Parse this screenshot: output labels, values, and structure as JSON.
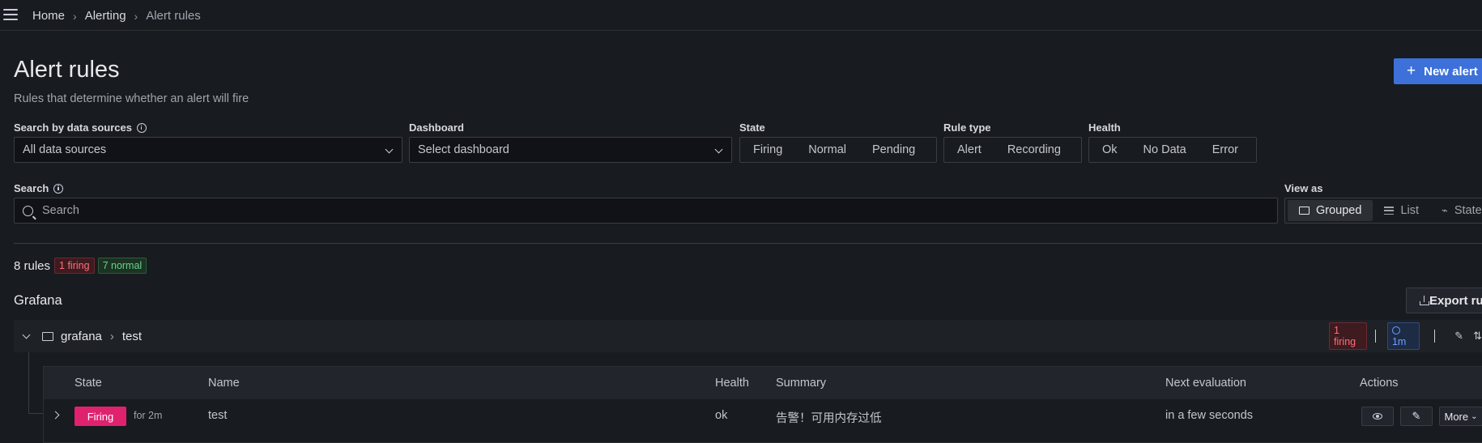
{
  "breadcrumb": {
    "home": "Home",
    "alerting": "Alerting",
    "current": "Alert rules"
  },
  "page": {
    "title": "Alert rules",
    "subtitle": "Rules that determine whether an alert will fire"
  },
  "toolbar": {
    "new_alert_label": "New alert rule",
    "export_label": "Export rules"
  },
  "filters": {
    "datasource_label": "Search by data sources",
    "datasource_value": "All data sources",
    "dashboard_label": "Dashboard",
    "dashboard_placeholder": "Select dashboard",
    "state_label": "State",
    "state_options": [
      "Firing",
      "Normal",
      "Pending"
    ],
    "ruletype_label": "Rule type",
    "ruletype_options": [
      "Alert",
      "Recording"
    ],
    "health_label": "Health",
    "health_options": [
      "Ok",
      "No Data",
      "Error"
    ],
    "search_label": "Search",
    "search_placeholder": "Search",
    "viewas_label": "View as",
    "viewas_options": [
      "Grouped",
      "List",
      "State"
    ],
    "viewas_selected": "Grouped"
  },
  "summary": {
    "count_text": "8 rules",
    "firing_badge": "1 firing",
    "normal_badge": "7 normal"
  },
  "section": {
    "title": "Grafana"
  },
  "group": {
    "folder": "grafana",
    "name": "test",
    "firing_badge": "1 firing",
    "interval": "1m"
  },
  "table": {
    "headers": {
      "state": "State",
      "name": "Name",
      "health": "Health",
      "summary": "Summary",
      "next_eval": "Next evaluation",
      "actions": "Actions"
    },
    "rows": [
      {
        "state": "Firing",
        "duration": "for 2m",
        "name": "test",
        "health": "ok",
        "summary": "告警！可用内存过低",
        "next_eval": "in a few seconds",
        "more_label": "More"
      }
    ]
  },
  "colors": {
    "firing": "#e0226e",
    "primary": "#3d71d9",
    "background": "#181b1f"
  }
}
